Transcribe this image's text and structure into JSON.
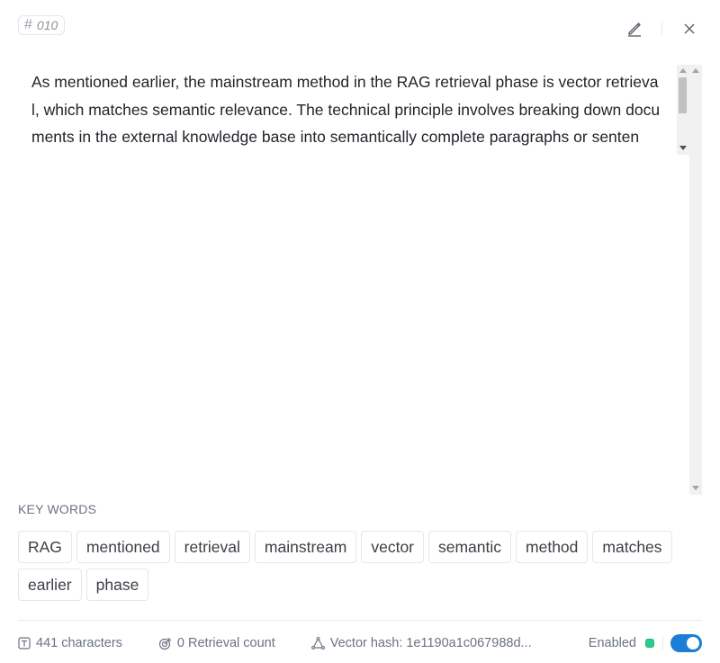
{
  "segment": {
    "hash_symbol": "#",
    "number": "010"
  },
  "header": {
    "edit_icon": "edit-icon",
    "close_icon": "close-icon"
  },
  "content": {
    "text": "As mentioned earlier, the mainstream method in the RAG retrieval phase is vector retrieval, which matches semantic relevance. The technical principle involves breaking down documents in the external knowledge base into semantically complete paragraphs or senten"
  },
  "keywords": {
    "title": "KEY WORDS",
    "items": [
      "RAG",
      "mentioned",
      "retrieval",
      "mainstream",
      "vector",
      "semantic",
      "method",
      "matches",
      "earlier",
      "phase"
    ]
  },
  "footer": {
    "characters": "441 characters",
    "retrieval_count": "0 Retrieval count",
    "vector_hash": "Vector hash: 1e1190a1c067988d...",
    "status_label": "Enabled",
    "status_color": "#2fca8f",
    "toggle_on": true,
    "toggle_color": "#1c7ed6"
  }
}
